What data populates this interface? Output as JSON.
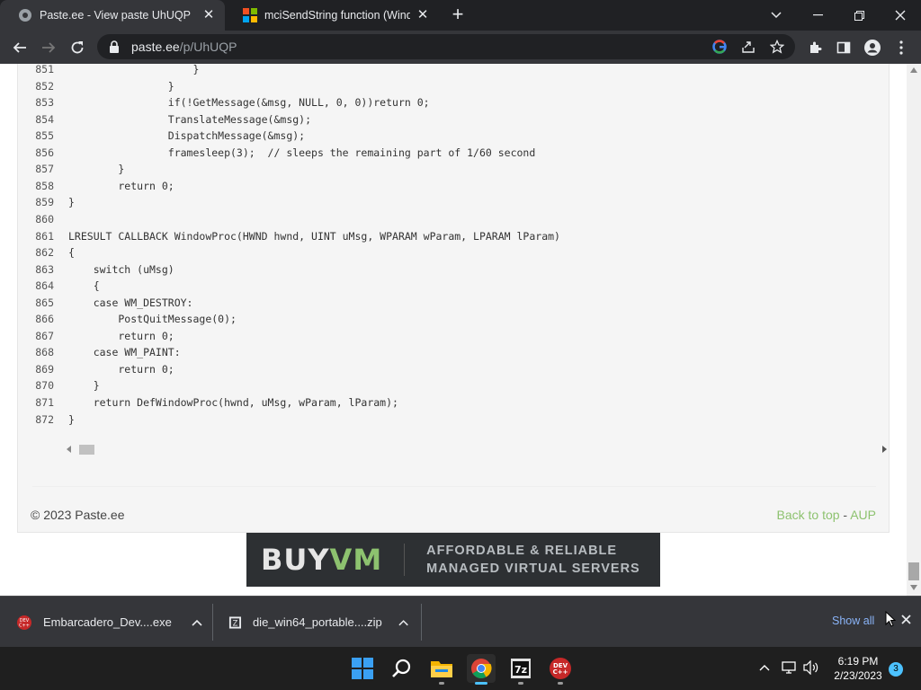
{
  "browser": {
    "tabs": [
      {
        "title": "Paste.ee - View paste UhUQP",
        "favicon": "paste-ee-icon",
        "active": true
      },
      {
        "title": "mciSendString function (Window",
        "favicon": "microsoft-icon",
        "active": false
      }
    ],
    "url_host": "paste.ee",
    "url_path": "/p/UhUQP"
  },
  "code": {
    "lines": [
      {
        "n": "851",
        "t": "                    }"
      },
      {
        "n": "852",
        "t": "                }"
      },
      {
        "n": "853",
        "t": "                if(!GetMessage(&msg, NULL, 0, 0))return 0;"
      },
      {
        "n": "854",
        "t": "                TranslateMessage(&msg);"
      },
      {
        "n": "855",
        "t": "                DispatchMessage(&msg);"
      },
      {
        "n": "856",
        "t": "                framesleep(3);  // sleeps the remaining part of 1/60 second"
      },
      {
        "n": "857",
        "t": "        }"
      },
      {
        "n": "858",
        "t": "        return 0;"
      },
      {
        "n": "859",
        "t": "}"
      },
      {
        "n": "860",
        "t": ""
      },
      {
        "n": "861",
        "t": "LRESULT CALLBACK WindowProc(HWND hwnd, UINT uMsg, WPARAM wParam, LPARAM lParam)"
      },
      {
        "n": "862",
        "t": "{"
      },
      {
        "n": "863",
        "t": "    switch (uMsg)"
      },
      {
        "n": "864",
        "t": "    {"
      },
      {
        "n": "865",
        "t": "    case WM_DESTROY:"
      },
      {
        "n": "866",
        "t": "        PostQuitMessage(0);"
      },
      {
        "n": "867",
        "t": "        return 0;"
      },
      {
        "n": "868",
        "t": "    case WM_PAINT:"
      },
      {
        "n": "869",
        "t": "        return 0;"
      },
      {
        "n": "870",
        "t": "    }"
      },
      {
        "n": "871",
        "t": "    return DefWindowProc(hwnd, uMsg, wParam, lParam);"
      },
      {
        "n": "872",
        "t": "}"
      }
    ]
  },
  "footer": {
    "copyright": "© 2023 Paste.ee",
    "back_to_top": "Back to top",
    "separator": " - ",
    "aup": "AUP"
  },
  "ad": {
    "brand_buy": "BUY",
    "brand_vm": "VM",
    "tagline_1": "AFFORDABLE & RELIABLE",
    "tagline_2": "MANAGED VIRTUAL SERVERS"
  },
  "downloads": {
    "items": [
      {
        "name": "Embarcadero_Dev....exe",
        "icon": "devcpp-icon"
      },
      {
        "name": "die_win64_portable....zip",
        "icon": "zip-archive-icon"
      }
    ],
    "show_all": "Show all"
  },
  "taskbar": {
    "time": "6:19 PM",
    "date": "2/23/2023",
    "notifications": "3",
    "apps": [
      "windows-start-icon",
      "search-icon",
      "file-explorer-icon",
      "chrome-icon",
      "7zip-icon",
      "devcpp-icon"
    ]
  },
  "colors": {
    "accent_green": "#8dc26f",
    "chrome_dark": "#35363a",
    "show_all_blue": "#8ab4f8"
  }
}
